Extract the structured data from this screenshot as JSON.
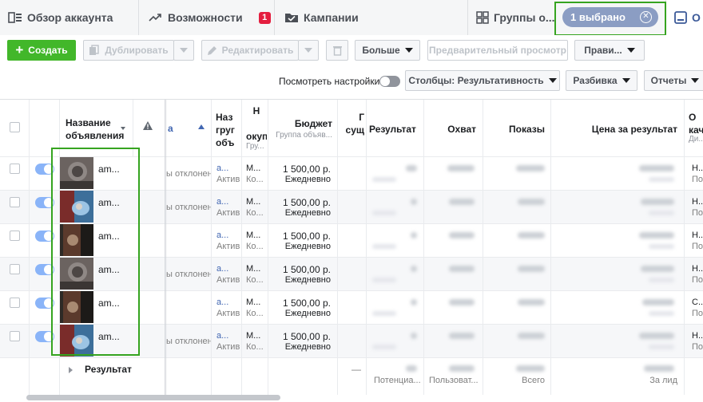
{
  "tabs": [
    {
      "label": "Обзор аккаунта",
      "icon": "account-overview-icon"
    },
    {
      "label": "Возможности",
      "icon": "trend-icon",
      "badge": "1"
    },
    {
      "label": "Кампании",
      "icon": "folder-icon"
    },
    {
      "label": "Группы о...",
      "icon": "grid-icon"
    },
    {
      "label": "О",
      "icon": "ad-icon"
    }
  ],
  "selection": {
    "label": "1 выбрано",
    "clear_icon": "close-circle-icon"
  },
  "toolbar": {
    "create": "Создать",
    "duplicate": "Дублировать",
    "edit": "Редактировать",
    "more": "Больше",
    "preview": "Предварительный просмотр",
    "rules": "Прави..."
  },
  "view_bar": {
    "view_settings": "Посмотреть настройки",
    "columns": "Столбцы: Результативность",
    "breakdown": "Разбивка",
    "reports": "Отчеты"
  },
  "columns": {
    "ad_name": "Название\nобъявления",
    "group_name": "Наз\nгруг\nобъ",
    "optimization": "Н\n\nокуп",
    "optimization_sub": "Гру...",
    "budget": "Бюджет",
    "budget_sub": "Группа объяв...",
    "attribution": "Г\nсущ",
    "results": "Результат",
    "reach": "Охват",
    "impressions": "Показы",
    "cost_per_result": "Цена за результат",
    "quality": "О\nкач",
    "quality_sub": "Ди..."
  },
  "rows": [
    {
      "name": "am...",
      "status": "ы отклонен",
      "group": "а...",
      "group_status": "Актив",
      "opt": "М...",
      "opt_sub": "Ко...",
      "budget": "1 500,00 р.",
      "budget_period": "Ежедневно",
      "quality": "Н...",
      "quality_sub": "По..."
    },
    {
      "name": "am...",
      "status": "ы отклонен",
      "group": "а...",
      "group_status": "Актив",
      "opt": "М...",
      "opt_sub": "Ко...",
      "budget": "1 500,00 р.",
      "budget_period": "Ежедневно",
      "quality": "Н...",
      "quality_sub": "По..."
    },
    {
      "name": "am...",
      "status": "",
      "group": "а...",
      "group_status": "Актив",
      "opt": "М...",
      "opt_sub": "Ко...",
      "budget": "1 500,00 р.",
      "budget_period": "Ежедневно",
      "quality": "Н...",
      "quality_sub": "По..."
    },
    {
      "name": "am...",
      "status": "ы отклонен",
      "group": "а...",
      "group_status": "Актив",
      "opt": "М...",
      "opt_sub": "Ко...",
      "budget": "1 500,00 р.",
      "budget_period": "Ежедневно",
      "quality": "Н...",
      "quality_sub": "По..."
    },
    {
      "name": "am...",
      "status": "",
      "group": "а...",
      "group_status": "Актив",
      "opt": "М...",
      "opt_sub": "Ко...",
      "budget": "1 500,00 р.",
      "budget_period": "Ежедневно",
      "quality": "С...",
      "quality_sub": "По..."
    },
    {
      "name": "am...",
      "status": "ы отклонен",
      "group": "а...",
      "group_status": "Актив",
      "opt": "М...",
      "opt_sub": "Ко...",
      "budget": "1 500,00 р.",
      "budget_period": "Ежедневно",
      "quality": "Н...",
      "quality_sub": "По..."
    }
  ],
  "summary": {
    "label": "Результат",
    "optimization": "—",
    "results_sub": "Потенциа...",
    "reach_sub": "Пользоват...",
    "impressions_sub": "Всего",
    "cost_sub": "За лид"
  },
  "colors": {
    "accent_green": "#42b72a",
    "highlight_green": "#36a420",
    "toggle_blue": "#8ab4f8",
    "badge_red": "#e41e3f"
  }
}
